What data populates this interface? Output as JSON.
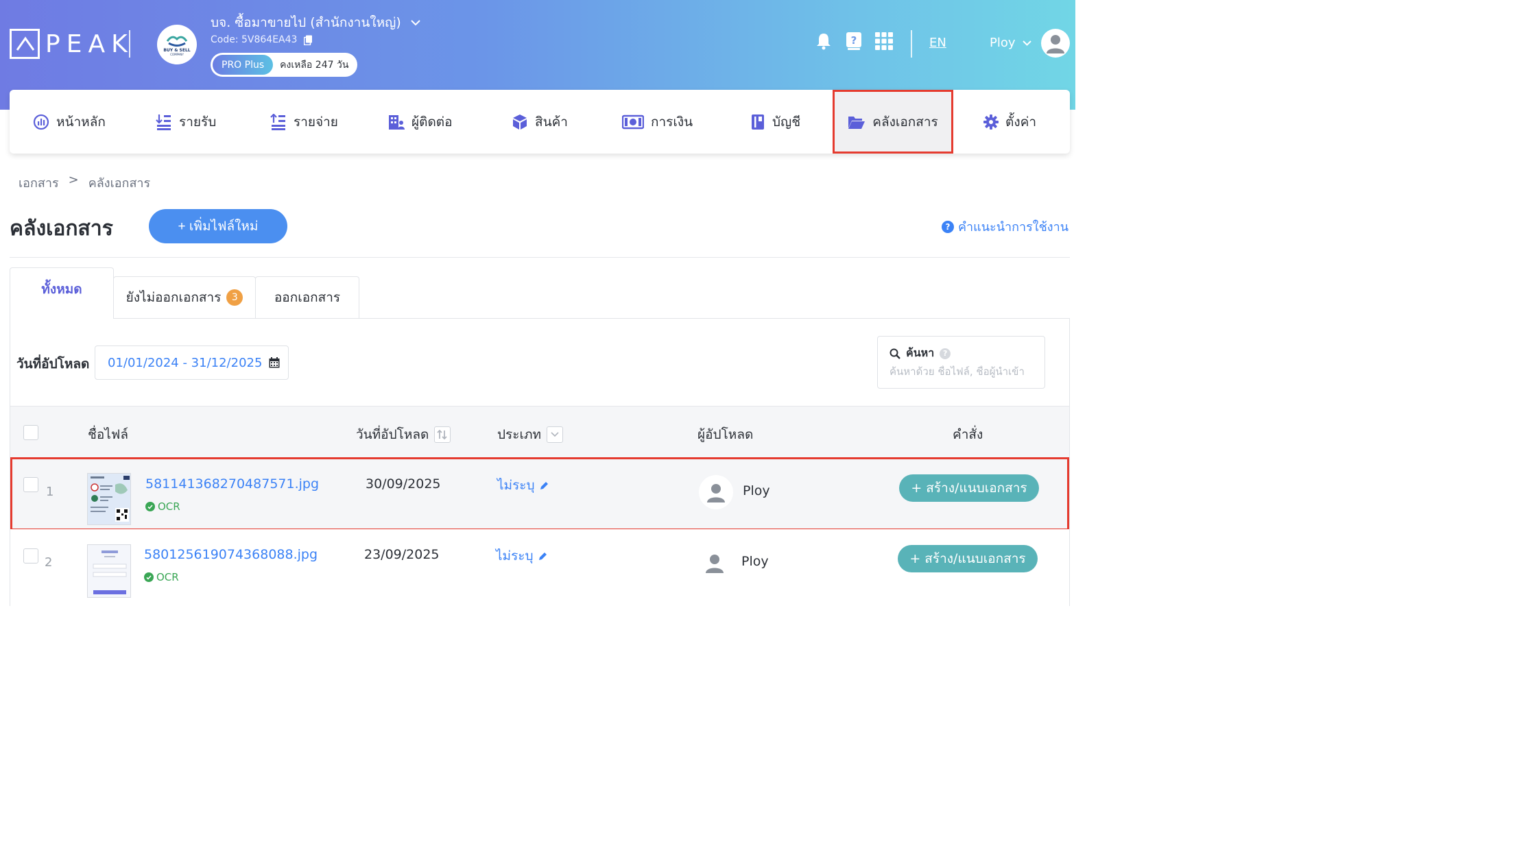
{
  "header": {
    "logo_text": "PEAK",
    "company_name": "บจ. ซื้อมาขายไป (สำนักงานใหญ่)",
    "company_code": "Code: 5V864EA43",
    "company_logo_text": "BUY & SELL",
    "company_logo_sub": "COMPANY",
    "plan": "PRO Plus",
    "days_left": "คงเหลือ 247 วัน",
    "lang": "EN",
    "user": "Ploy"
  },
  "nav": [
    {
      "label": "หน้าหลัก",
      "icon": "dashboard-icon"
    },
    {
      "label": "รายรับ",
      "icon": "income-icon"
    },
    {
      "label": "รายจ่าย",
      "icon": "expense-icon"
    },
    {
      "label": "ผู้ติดต่อ",
      "icon": "contacts-icon"
    },
    {
      "label": "สินค้า",
      "icon": "product-box-icon"
    },
    {
      "label": "การเงิน",
      "icon": "money-icon"
    },
    {
      "label": "บัญชี",
      "icon": "account-book-icon"
    },
    {
      "label": "คลังเอกสาร",
      "icon": "folder-open-icon"
    },
    {
      "label": "ตั้งค่า",
      "icon": "gear-icon"
    }
  ],
  "breadcrumb": {
    "root": "เอกสาร",
    "sep": ">",
    "current": "คลังเอกสาร"
  },
  "page": {
    "title": "คลังเอกสาร",
    "add_button": "+ เพิ่มไฟล์ใหม่",
    "help": "คำแนะนำการใช้งาน"
  },
  "tabs": [
    {
      "label": "ทั้งหมด"
    },
    {
      "label": "ยังไม่ออกเอกสาร",
      "count": "3"
    },
    {
      "label": "ออกเอกสาร"
    }
  ],
  "filter": {
    "date_label": "วันที่อัปโหลด",
    "date_value": "01/01/2024 - 31/12/2025",
    "search_title": "ค้นหา",
    "search_placeholder": "ค้นหาด้วย ชื่อไฟล์, ชื่อผู้นำเข้า"
  },
  "table": {
    "columns": {
      "file": "ชื่อไฟล์",
      "date": "วันที่อัปโหลด",
      "type": "ประเภท",
      "uploader": "ผู้อัปโหลด",
      "action": "คำสั่ง"
    },
    "rows": [
      {
        "no": "1",
        "file": "581141368270487571.jpg",
        "ocr": "OCR",
        "date": "30/09/2025",
        "type": "ไม่ระบุ",
        "user": "Ploy",
        "action": "+ สร้าง/แนบเอกสาร"
      },
      {
        "no": "2",
        "file": "580125619074368088.jpg",
        "ocr": "OCR",
        "date": "23/09/2025",
        "type": "ไม่ระบุ",
        "user": "Ploy",
        "action": "+ สร้าง/แนบเอกสาร"
      }
    ]
  },
  "colors": {
    "accent": "#4b8ff0",
    "action": "#59b3b8",
    "highlight": "#e53b2f",
    "badge": "#f0a044"
  }
}
